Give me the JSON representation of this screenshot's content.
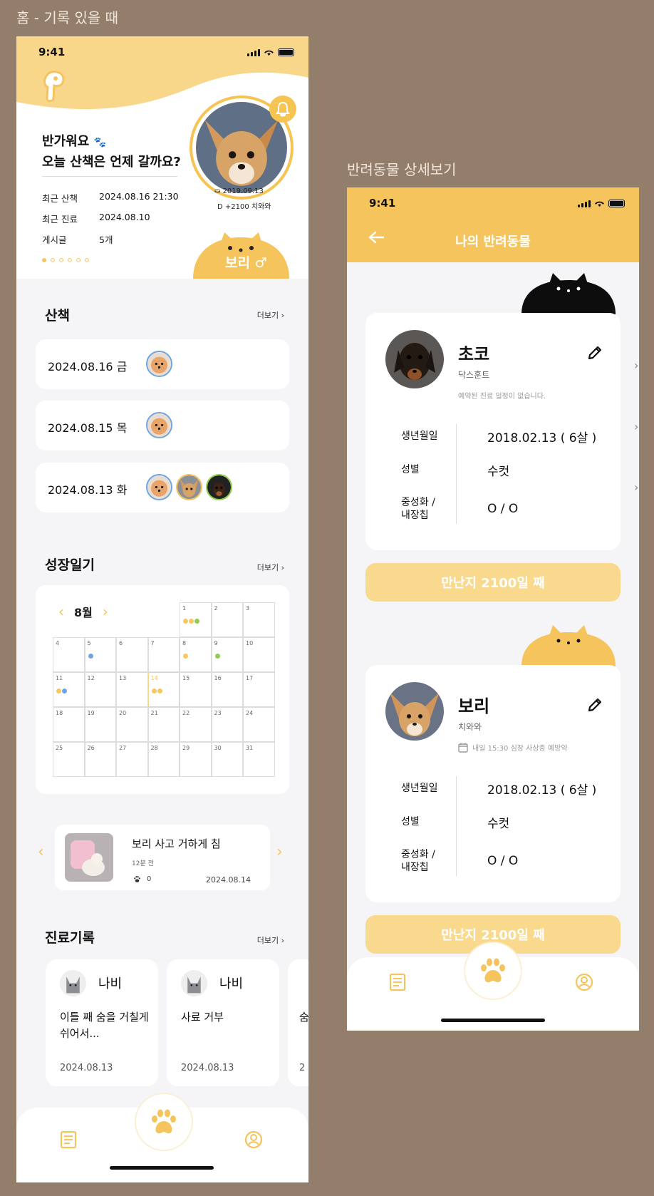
{
  "labels": {
    "home_screen": "홈 - 기록 있을 때",
    "detail_screen": "반려동물 상세보기"
  },
  "status_time": "9:41",
  "home": {
    "greeting_line1": "반가워요",
    "greeting_line2": "오늘 산책은 언제 갈까요?",
    "info": [
      {
        "label": "최근 산책",
        "value": "2024.08.16 21:30"
      },
      {
        "label": "최근 진료",
        "value": "2024.08.10"
      },
      {
        "label": "게시글",
        "value": "5개"
      }
    ],
    "pet": {
      "birth": "2019.09.13",
      "dday": "D +2100  치와와",
      "name": "보리 ♂"
    },
    "walk": {
      "title": "산책",
      "more": "더보기 ›",
      "entries": [
        {
          "date": "2024.08.16 금"
        },
        {
          "date": "2024.08.15 목"
        },
        {
          "date": "2024.08.13 화"
        }
      ]
    },
    "growth": {
      "title": "성장일기",
      "more": "더보기 ›",
      "month": "8월",
      "prev": "‹",
      "next": "›",
      "days": [
        "1",
        "2",
        "3",
        "4",
        "5",
        "6",
        "7",
        "8",
        "9",
        "10",
        "11",
        "12",
        "13",
        "14",
        "15",
        "16",
        "17",
        "18",
        "19",
        "20",
        "21",
        "22",
        "23",
        "24",
        "25",
        "26",
        "27",
        "28",
        "29",
        "30",
        "31"
      ],
      "colors": {
        "yellow": "#f5c95e",
        "green": "#8fcf4d",
        "blue": "#6fa4e5"
      }
    },
    "diary": {
      "title": "보리 사고 거하게 침",
      "ago": "12분 전",
      "likes": "0",
      "date": "2024.08.14",
      "prev": "‹",
      "next": "›"
    },
    "medical": {
      "title": "진료기록",
      "more": "더보기 ›",
      "cards": [
        {
          "name": "나비",
          "desc": "이틀 째 숨을 거칠게 쉬어서...",
          "date": "2024.08.13"
        },
        {
          "name": "나비",
          "desc": "사료 거부",
          "date": "2024.08.13"
        },
        {
          "name": "",
          "desc": "숨",
          "date": "2"
        }
      ]
    }
  },
  "detail": {
    "title": "나의 반려동물",
    "pets": [
      {
        "name": "초코",
        "breed": "닥스훈트",
        "schedule": "예약된 진료 일정이 없습니다.",
        "birth_label": "생년월일",
        "birth": "2018.02.13  ( 6살 )",
        "sex_label": "성별",
        "sex": "수컷",
        "neuter_label": "중성화 / 내장칩",
        "neuter": "O / O",
        "meet": "만난지 2100일 째"
      },
      {
        "name": "보리",
        "breed": "치와와",
        "schedule": "내일 15:30 심장 사상충 예방약",
        "birth_label": "생년월일",
        "birth": "2018.02.13  ( 6살 )",
        "sex_label": "성별",
        "sex": "수컷",
        "neuter_label": "중성화 / 내장칩",
        "neuter": "O / O",
        "meet": "만난지 2100일 째"
      }
    ]
  },
  "icons": [
    "logo-icon",
    "bell-icon",
    "paw-icon",
    "list-icon",
    "profile-icon",
    "back-arrow-icon",
    "edit-icon",
    "calendar-icon",
    "chevron-right-icon"
  ],
  "theme": {
    "accent": "#f5c45c",
    "accent_light": "#f9d98e",
    "background": "#937e6b"
  }
}
